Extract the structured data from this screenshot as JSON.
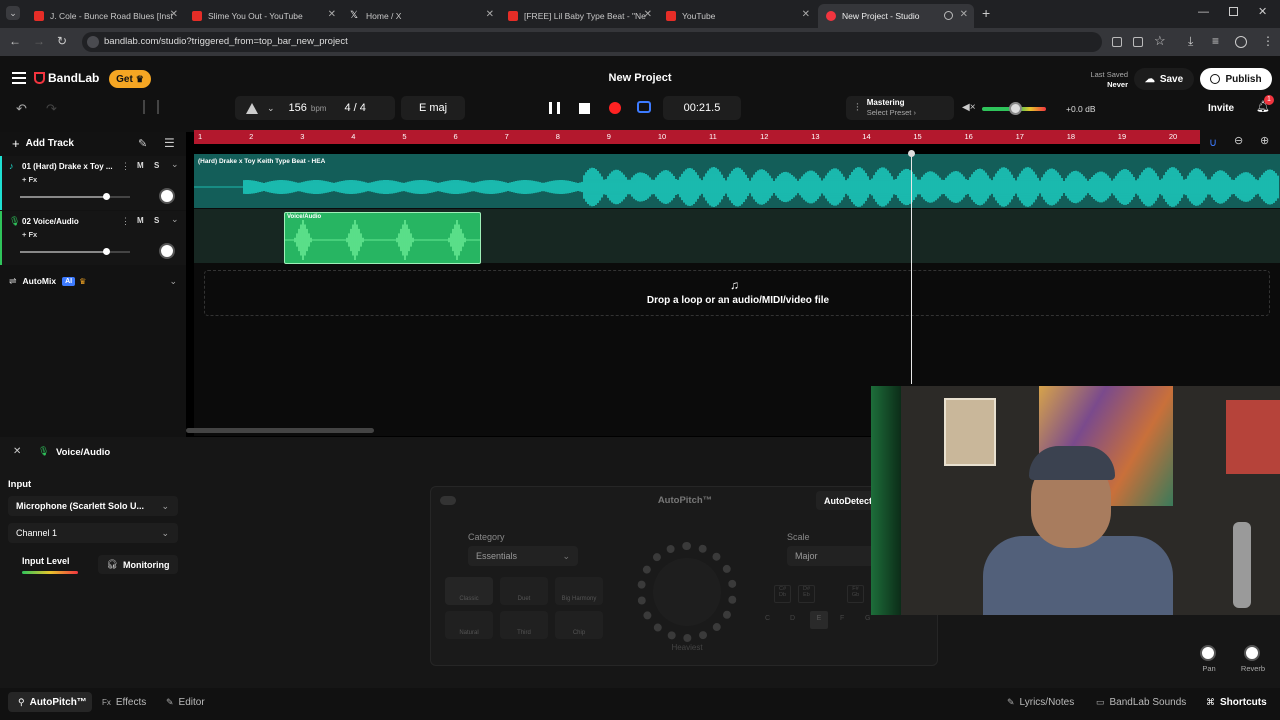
{
  "browser": {
    "tabs": [
      {
        "title": "J. Cole - Bunce Road Blues [Inst",
        "icon": "youtube-icon"
      },
      {
        "title": "Slime You Out - YouTube",
        "icon": "youtube-icon"
      },
      {
        "title": "Home / X",
        "icon": "x-icon"
      },
      {
        "title": "[FREE] Lil Baby Type Beat - \"Ne",
        "icon": "youtube-icon"
      },
      {
        "title": "YouTube",
        "icon": "youtube-icon"
      },
      {
        "title": "New Project - Studio",
        "icon": "bandlab-icon"
      }
    ],
    "url": "bandlab.com/studio?triggered_from=top_bar_new_project"
  },
  "header": {
    "brand": "BandLab",
    "get_label": "Get",
    "project_title": "New Project",
    "last_saved_label": "Last Saved",
    "last_saved_value": "Never",
    "save_label": "Save",
    "publish_label": "Publish",
    "invite_label": "Invite",
    "notification_count": "1"
  },
  "transport": {
    "tempo": "156",
    "tempo_unit": "bpm",
    "time_sig_num": "4",
    "time_sig_den": "4",
    "key": "E maj",
    "time": "00:21.5",
    "mastering_label": "Mastering",
    "mastering_select": "Select Preset",
    "volume_db": "+0.0 dB",
    "volume_level": 0.52
  },
  "tracks_panel": {
    "add_track_label": "Add Track",
    "automix_label": "AutoMix",
    "ai_badge": "AI",
    "tracks": [
      {
        "name": "01 (Hard) Drake x Toy ...",
        "fx_label": "+ Fx",
        "mute": "M",
        "solo": "S",
        "fader_level": 0.78
      },
      {
        "name": "02 Voice/Audio",
        "fx_label": "+ Fx",
        "mute": "M",
        "solo": "S",
        "fader_level": 0.78
      }
    ]
  },
  "timeline": {
    "ruler": [
      "1",
      "2",
      "3",
      "4",
      "5",
      "6",
      "7",
      "8",
      "9",
      "10",
      "11",
      "12",
      "13",
      "14",
      "15",
      "16",
      "17",
      "18",
      "19",
      "20"
    ],
    "clip1_name": "(Hard) Drake x Toy Keith Type Beat - HEA",
    "clip2_name": "Voice/Audio",
    "drop_text": "Drop a loop or an audio/MIDI/video file"
  },
  "bottom_panel": {
    "track_name": "Voice/Audio",
    "input_label": "Input",
    "input_device": "Microphone (Scarlett Solo U...",
    "channel": "Channel 1",
    "input_level_label": "Input Level",
    "monitoring_label": "Monitoring",
    "autopitch_title": "AutoPitch™",
    "autodetect_label": "AutoDetect",
    "category_label": "Category",
    "category_value": "Essentials",
    "scale_label": "Scale",
    "scale_value": "Major",
    "presets": [
      "Classic",
      "Duet",
      "Big Harmony",
      "Natural",
      "Third",
      "Chip"
    ],
    "knob_label": "Heaviest",
    "notes": [
      "C",
      "D",
      "E",
      "F",
      "G",
      "A",
      "B"
    ],
    "sharps": [
      "C#\nDb",
      "D#\nEb",
      "F#\nGb"
    ],
    "pan_label": "Pan",
    "reverb_label": "Reverb"
  },
  "bottom_bar": {
    "autopitch": "AutoPitch™",
    "effects": "Effects",
    "effects_prefix": "Fx",
    "editor": "Editor",
    "lyrics": "Lyrics/Notes",
    "sounds": "BandLab Sounds",
    "shortcuts": "Shortcuts"
  },
  "colors": {
    "brand_red": "#f2353f",
    "get_orange": "#f5a623",
    "ruler_red": "#b3182d",
    "track1_teal": "#135e59",
    "wave_cyan": "#1ee0d2",
    "clip_green": "#27b562"
  }
}
